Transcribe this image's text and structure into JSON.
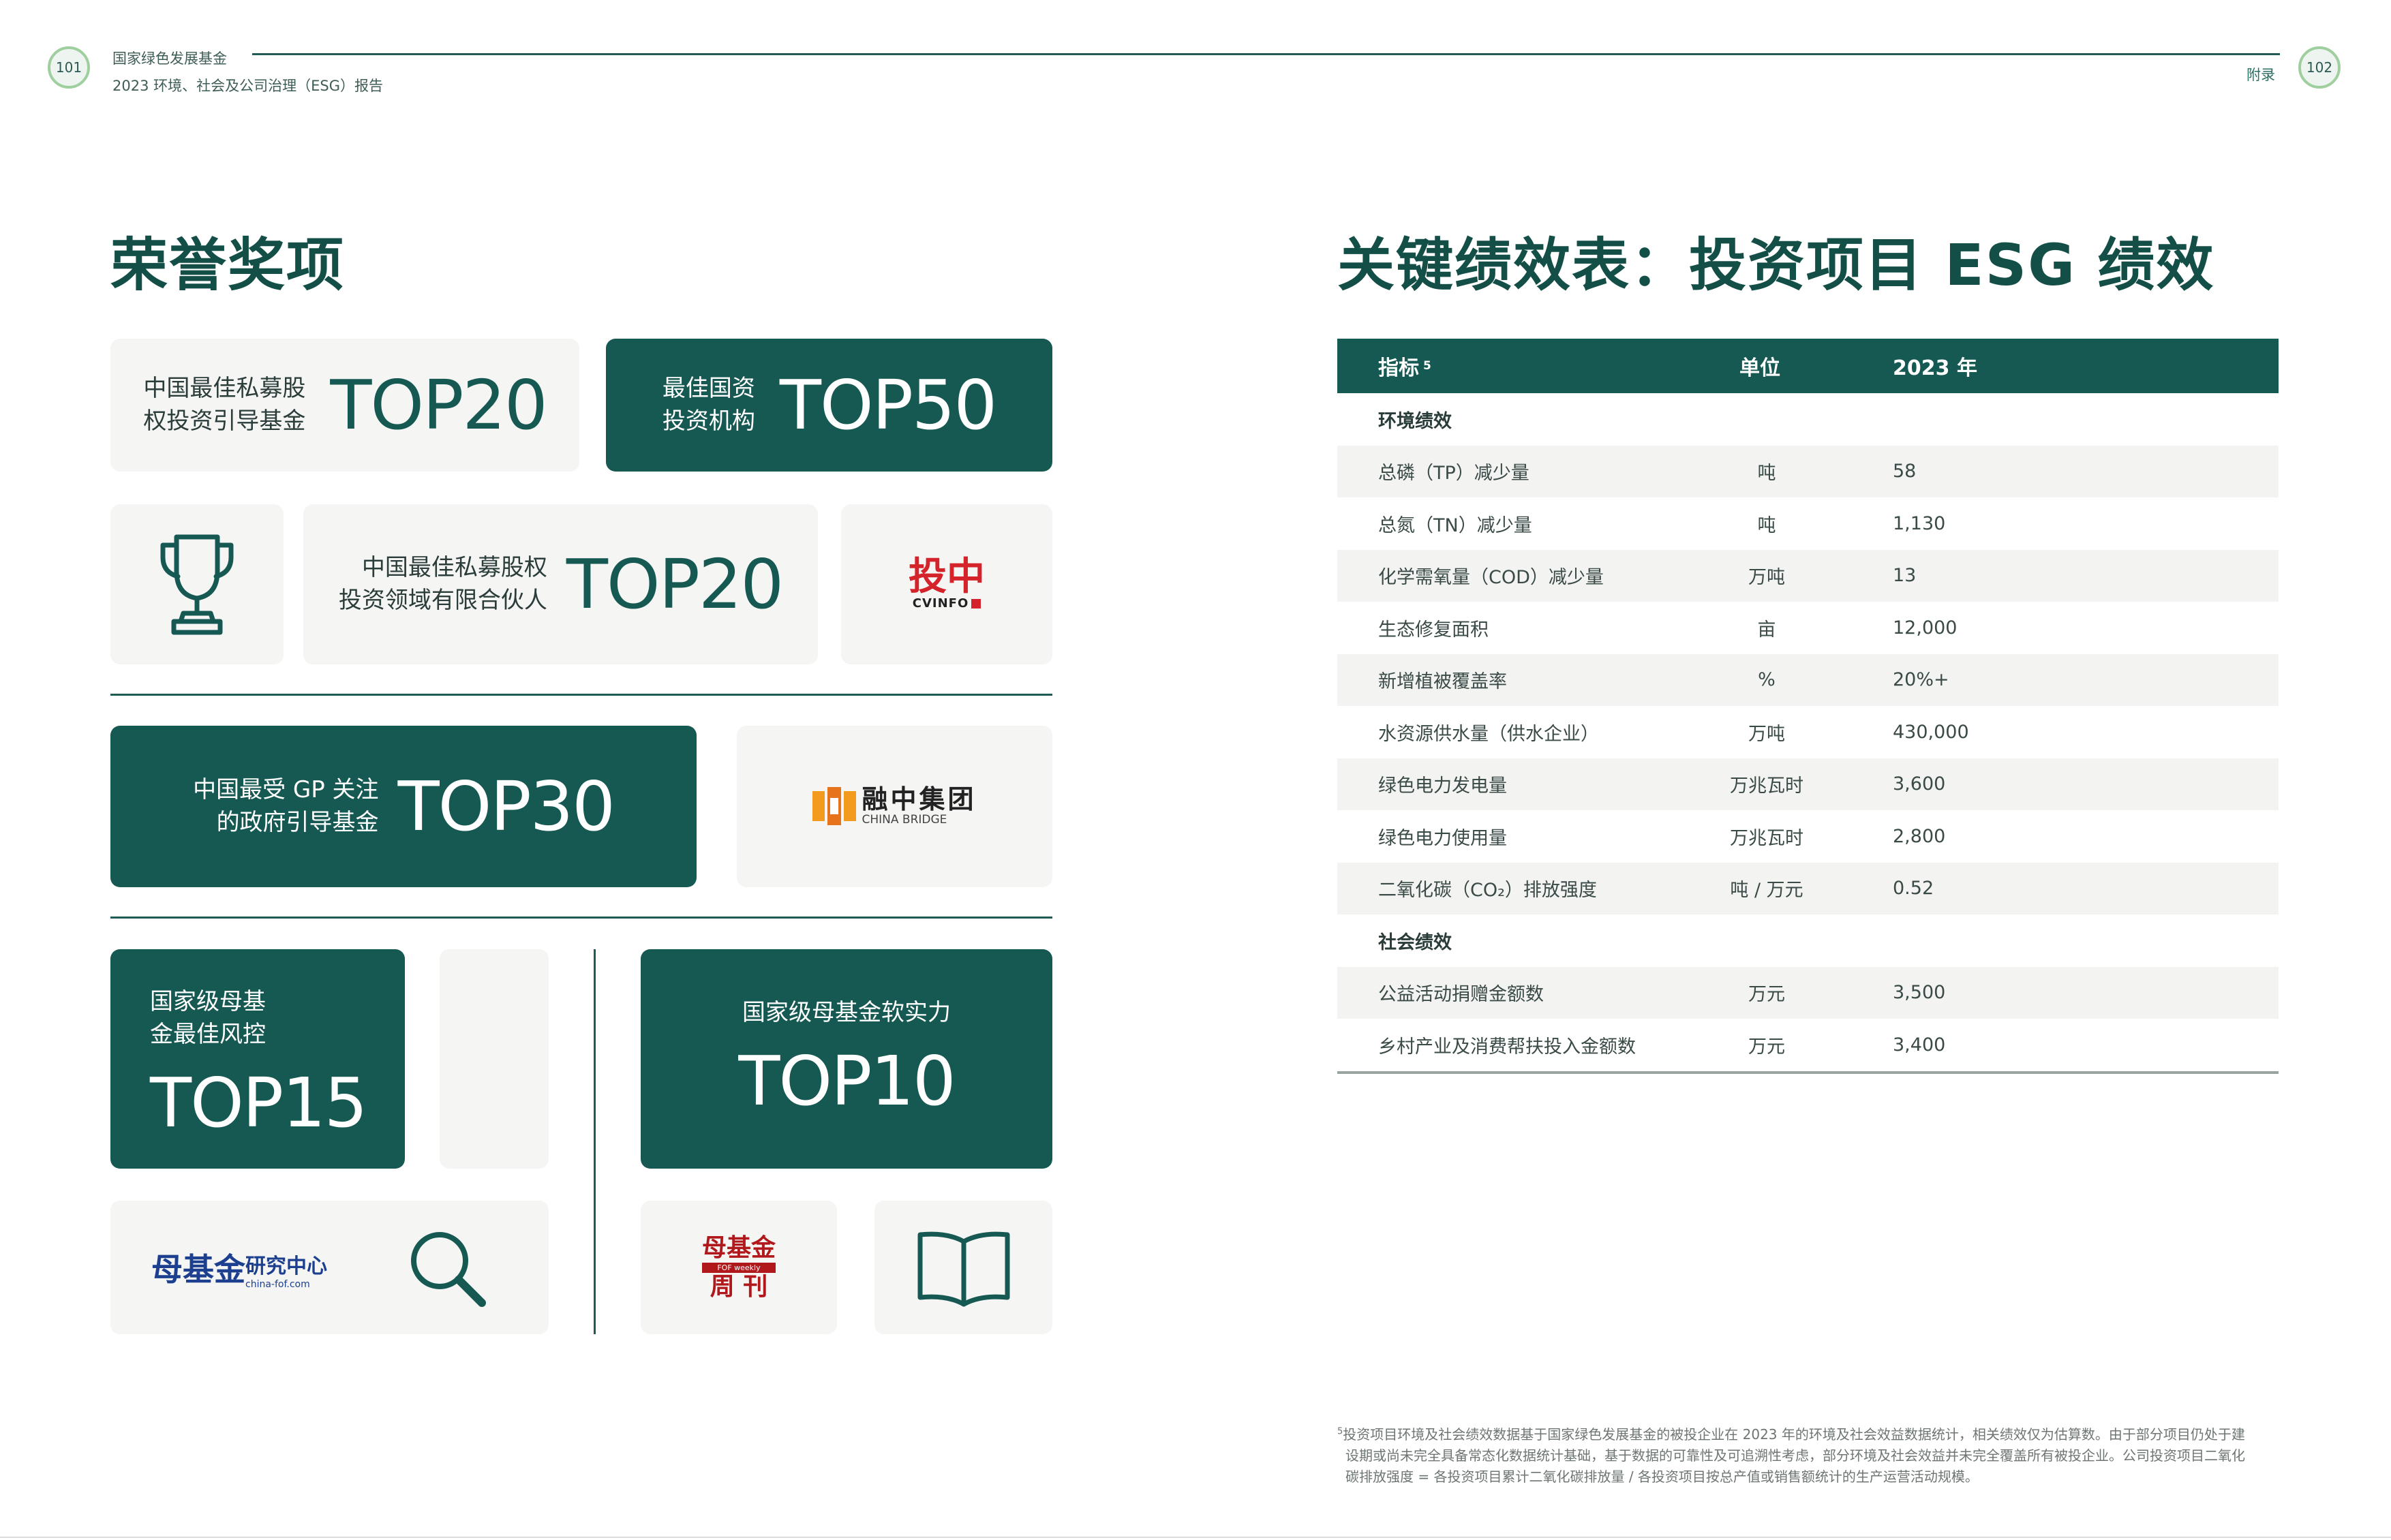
{
  "header": {
    "left_page": "101",
    "right_page": "102",
    "org_name": "国家绿色发展基金",
    "report_title": "2023 环境、社会及公司治理（ESG）报告",
    "section_label": "附录"
  },
  "awards": {
    "title": "荣誉奖项",
    "card1": {
      "label1": "中国最佳私募股",
      "label2": "权投资引导基金",
      "rank": "TOP20"
    },
    "card2": {
      "label1": "最佳国资",
      "label2": "投资机构",
      "rank": "TOP50"
    },
    "card3": {
      "label1": "中国最佳私募股权",
      "label2": "投资领域有限合伙人",
      "rank": "TOP20"
    },
    "card4": {
      "label1": "中国最受 GP 关注",
      "label2": "的政府引导基金",
      "rank": "TOP30"
    },
    "card5": {
      "label1": "国家级母基",
      "label2": "金最佳风控",
      "rank": "TOP15"
    },
    "card6": {
      "label1": "国家级母基金软实力",
      "rank": "TOP10"
    },
    "logos": {
      "cvinfo_cn": "投中",
      "cvinfo_en": "CVINFO",
      "chinabridge_cn": "融中集团",
      "chinabridge_en": "CHINA BRIDGE",
      "fof_cn": "母基金",
      "fof_sub": "研究中心",
      "fof_url": "china-fof.com",
      "fofweekly_top": "母基金",
      "fofweekly_en": "FOF weekly",
      "fofweekly_bottom": "周 刊"
    }
  },
  "kpi": {
    "title": "关键绩效表：投资项目 ESG 绩效",
    "columns": [
      "指标",
      "单位",
      "2023 年"
    ],
    "col1_sup": "5",
    "rows": [
      {
        "type": "section",
        "name": "环境绩效",
        "unit": "",
        "value": ""
      },
      {
        "type": "row",
        "name": "总磷（TP）减少量",
        "unit": "吨",
        "value": "58"
      },
      {
        "type": "row",
        "name": "总氮（TN）减少量",
        "unit": "吨",
        "value": "1,130"
      },
      {
        "type": "row",
        "name": "化学需氧量（COD）减少量",
        "unit": "万吨",
        "value": "13"
      },
      {
        "type": "row",
        "name": "生态修复面积",
        "unit": "亩",
        "value": "12,000"
      },
      {
        "type": "row",
        "name": "新增植被覆盖率",
        "unit": "%",
        "value": "20%+"
      },
      {
        "type": "row",
        "name": "水资源供水量（供水企业）",
        "unit": "万吨",
        "value": "430,000"
      },
      {
        "type": "row",
        "name": "绿色电力发电量",
        "unit": "万兆瓦时",
        "value": "3,600"
      },
      {
        "type": "row",
        "name": "绿色电力使用量",
        "unit": "万兆瓦时",
        "value": "2,800"
      },
      {
        "type": "row",
        "name": "二氧化碳（CO₂）排放强度",
        "unit": "吨 / 万元",
        "value": "0.52"
      },
      {
        "type": "section",
        "name": "社会绩效",
        "unit": "",
        "value": ""
      },
      {
        "type": "row",
        "name": "公益活动捐赠金额数",
        "unit": "万元",
        "value": "3,500"
      },
      {
        "type": "row",
        "name": "乡村产业及消费帮扶投入金额数",
        "unit": "万元",
        "value": "3,400"
      }
    ]
  },
  "footnote": {
    "sup": "5",
    "line1": "投资项目环境及社会绩效数据基于国家绿色发展基金的被投企业在 2023 年的环境及社会效益数据统计，相关绩效仅为估算数。由于部分项目仍处于建",
    "line2": "设期或尚未完全具备常态化数据统计基础，基于数据的可靠性及可追溯性考虑，部分环境及社会效益并未完全覆盖所有被投企业。公司投资项目二氧化",
    "line3": "碳排放强度 = 各投资项目累计二氧化碳排放量 / 各投资项目按总产值或销售额统计的生产运营活动规模。"
  }
}
